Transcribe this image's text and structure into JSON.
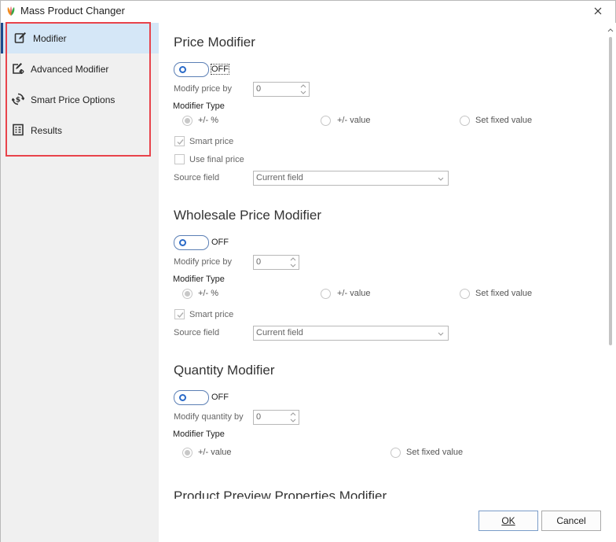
{
  "window": {
    "title": "Mass Product Changer"
  },
  "sidebar": {
    "items": [
      {
        "label": "Modifier",
        "icon": "edit-icon",
        "active": true
      },
      {
        "label": "Advanced Modifier",
        "icon": "advanced-edit-icon",
        "active": false
      },
      {
        "label": "Smart Price Options",
        "icon": "smart-price-icon",
        "active": false
      },
      {
        "label": "Results",
        "icon": "results-icon",
        "active": false
      }
    ]
  },
  "price_modifier": {
    "title": "Price Modifier",
    "toggle_state": "OFF",
    "modify_label": "Modify price by",
    "modify_value": "0",
    "type_label": "Modifier Type",
    "options": [
      "+/- %",
      "+/- value",
      "Set fixed value"
    ],
    "selected_option": "+/- %",
    "smart_price_label": "Smart price",
    "smart_price_checked": true,
    "use_final_label": "Use final price",
    "use_final_checked": false,
    "source_label": "Source field",
    "source_value": "Current field"
  },
  "wholesale_modifier": {
    "title": "Wholesale Price Modifier",
    "toggle_state": "OFF",
    "modify_label": "Modify price by",
    "modify_value": "0",
    "type_label": "Modifier Type",
    "options": [
      "+/- %",
      "+/- value",
      "Set fixed value"
    ],
    "selected_option": "+/- %",
    "smart_price_label": "Smart price",
    "smart_price_checked": true,
    "source_label": "Source field",
    "source_value": "Current field"
  },
  "quantity_modifier": {
    "title": "Quantity Modifier",
    "toggle_state": "OFF",
    "modify_label": "Modify quantity by",
    "modify_value": "0",
    "type_label": "Modifier Type",
    "options": [
      "+/- value",
      "Set fixed value"
    ],
    "selected_option": "+/- value"
  },
  "preview_modifier": {
    "title": "Product Preview Properties Modifier"
  },
  "footer": {
    "ok_label": "OK",
    "cancel_label": "Cancel"
  },
  "colors": {
    "accent": "#1d4a8c",
    "sidebar_active_bg": "#d5e7f7",
    "highlight_border": "#e8434b",
    "toggle_border": "#5b7fb5"
  }
}
